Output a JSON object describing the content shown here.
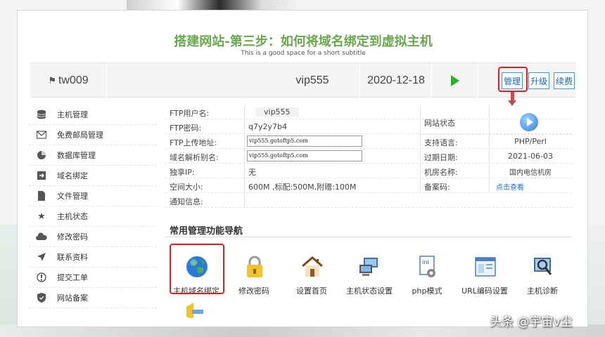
{
  "slide": {
    "title": "搭建网站-第三步：如何将域名绑定到虚拟主机",
    "subtitle": "This is a good space for a short subtitle"
  },
  "bar": {
    "account": "tw009",
    "plan": "vip555",
    "date": "2020-12-18",
    "buttons": [
      "管理",
      "升级",
      "续费"
    ]
  },
  "sidebar": {
    "items": [
      {
        "label": "主机管理",
        "icon": "database-icon"
      },
      {
        "label": "免费邮局管理",
        "icon": "mail-icon"
      },
      {
        "label": "数据库管理",
        "icon": "pie-chart-icon"
      },
      {
        "label": "域名绑定",
        "icon": "arrow-box-icon"
      },
      {
        "label": "文件管理",
        "icon": "file-icon"
      },
      {
        "label": "主机状态",
        "icon": "star-icon"
      },
      {
        "label": "修改密码",
        "icon": "cloud-icon"
      },
      {
        "label": "联系资料",
        "icon": "send-icon"
      },
      {
        "label": "提交工单",
        "icon": "ticket-icon"
      },
      {
        "label": "网站备案",
        "icon": "shield-icon"
      }
    ]
  },
  "info": {
    "ftp_user_label": "FTP用户名:",
    "ftp_user": "vip555",
    "ftp_pass_label": "FTP密码:",
    "ftp_pass": "q7y2y7b4",
    "ftp_upload_label": "FTP上传地址:",
    "ftp_upload": "vip555.gotoftp5.com",
    "alias_label": "域名解析别名:",
    "alias": "vip555.gotoftp5.com",
    "ip_label": "独享IP:",
    "ip": "无",
    "space_label": "空间大小:",
    "space": "600M ,标配:500M,附赠:100M",
    "notice_label": "通知信息:",
    "status_label": "网站状态",
    "lang_label": "支持语言:",
    "lang": "PHP/Perl",
    "expire_label": "过期日期:",
    "expire": "2021-06-03",
    "room_label": "机房名称:",
    "room": "国内电信机房",
    "icp_label": "备案码:",
    "icp_link": "点击查看"
  },
  "functions": {
    "title": "常用管理功能导航",
    "items": [
      {
        "label": "主机域名绑定",
        "icon": "globe-icon"
      },
      {
        "label": "修改密码",
        "icon": "lock-icon"
      },
      {
        "label": "设置首页",
        "icon": "home-icon"
      },
      {
        "label": "主机状态设置",
        "icon": "computer-icon"
      },
      {
        "label": "php模式",
        "icon": "ini-file-icon"
      },
      {
        "label": "URL编码设置",
        "icon": "window-icon"
      },
      {
        "label": "主机诊断",
        "icon": "magnifier-icon"
      }
    ]
  },
  "watermark": "头条 @宇宙v尘"
}
